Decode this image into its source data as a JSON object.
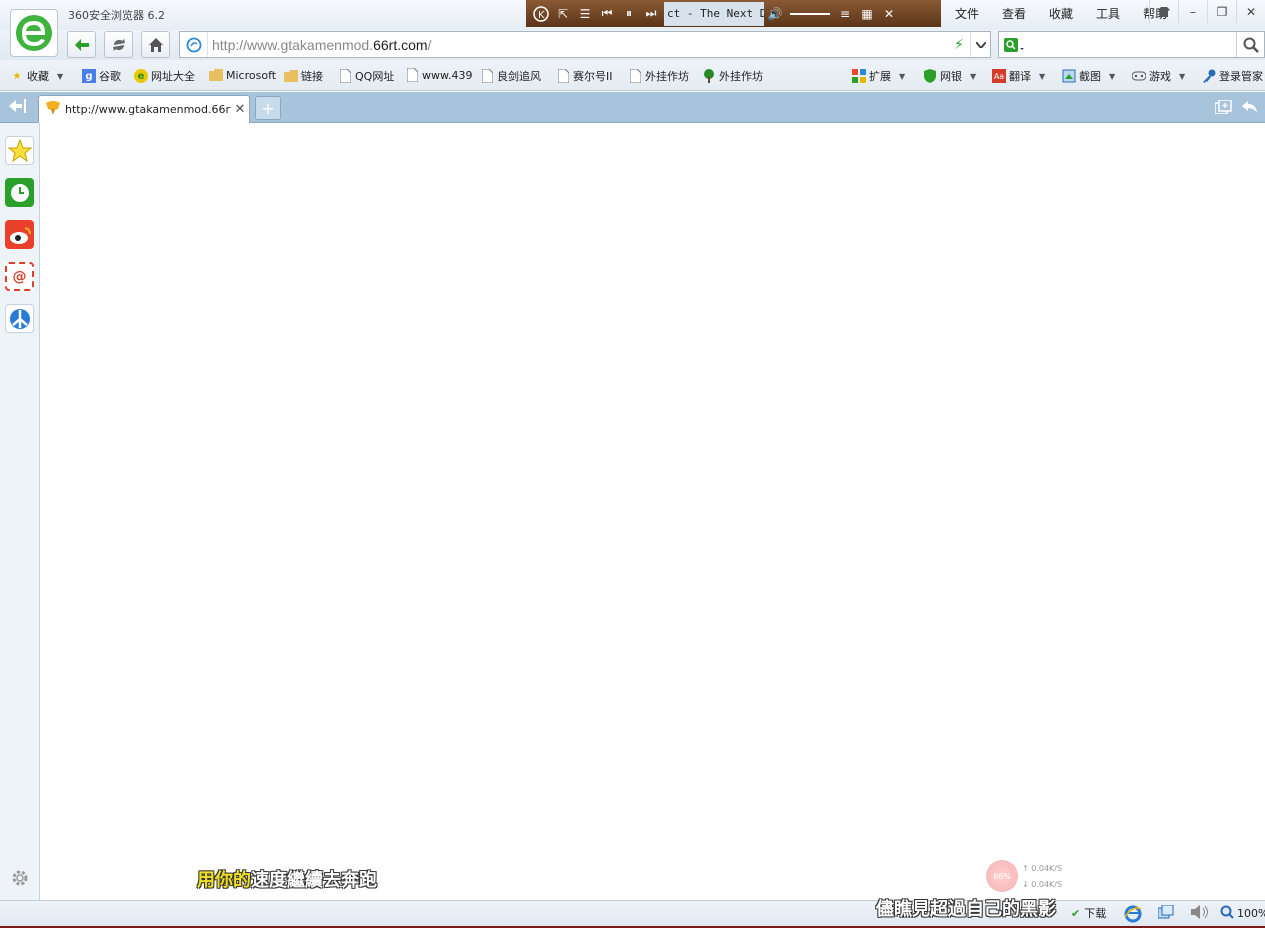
{
  "app": {
    "title": "360安全浏览器 6.2"
  },
  "menu": [
    "文件",
    "查看",
    "收藏",
    "工具",
    "帮助"
  ],
  "window_buttons": {
    "skin": "skin-icon",
    "minimize": "–",
    "restore": "❐",
    "close": "✕"
  },
  "player": {
    "song": "ct - The Next Dec"
  },
  "nav": {
    "url_prefix": "http://www.gtakamenmod.",
    "url_domain": "66rt.com",
    "url_suffix": "/",
    "search_placeholder": ""
  },
  "bookmarks": {
    "favorites": "收藏",
    "items": [
      {
        "label": "谷歌"
      },
      {
        "label": "网址大全"
      },
      {
        "label": "Microsoft"
      },
      {
        "label": "链接"
      },
      {
        "label": "QQ网址"
      },
      {
        "label": "www.439"
      },
      {
        "label": "良剑追风"
      },
      {
        "label": "赛尔号II"
      },
      {
        "label": "外挂作坊"
      },
      {
        "label": "外挂作坊"
      }
    ],
    "right": [
      {
        "label": "扩展"
      },
      {
        "label": "网银"
      },
      {
        "label": "翻译"
      },
      {
        "label": "截图"
      },
      {
        "label": "游戏"
      },
      {
        "label": "登录管家"
      }
    ]
  },
  "tab": {
    "title": "http://www.gtakamenmod.66rt.c"
  },
  "subtitles": {
    "line1_highlight": "用你的",
    "line1_rest": "速度繼續去奔跑",
    "line2": "儘瞧見超過自己的黑影"
  },
  "speed": {
    "percent": "66%",
    "up": "↑ 0.04K/S",
    "down": "↓ 0.04K/S"
  },
  "status": {
    "download": "下载",
    "zoom": "100%"
  },
  "colors": {
    "accent": "#2aa02a",
    "tabstrip": "#a8c4dc"
  }
}
